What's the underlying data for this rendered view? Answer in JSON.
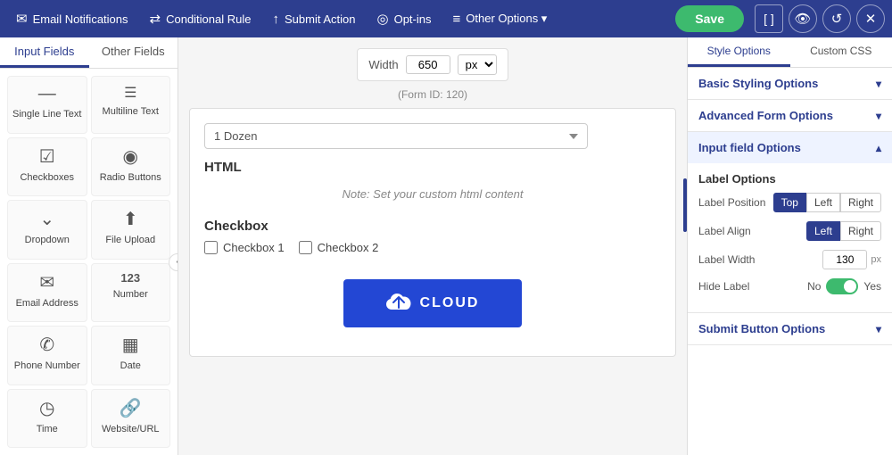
{
  "nav": {
    "items": [
      {
        "id": "email-notifications",
        "icon": "✉",
        "label": "Email Notifications"
      },
      {
        "id": "conditional-rule",
        "icon": "⇄",
        "label": "Conditional Rule"
      },
      {
        "id": "submit-action",
        "icon": "↑",
        "label": "Submit Action"
      },
      {
        "id": "opt-ins",
        "icon": "◎",
        "label": "Opt-ins"
      },
      {
        "id": "other-options",
        "icon": "≡",
        "label": "Other Options ▾"
      }
    ],
    "save_label": "Save"
  },
  "left_panel": {
    "tabs": [
      {
        "id": "input-fields",
        "label": "Input Fields"
      },
      {
        "id": "other-fields",
        "label": "Other Fields"
      }
    ],
    "active_tab": "input-fields",
    "fields": [
      {
        "id": "single-line-text",
        "icon": "—",
        "label": "Single Line Text"
      },
      {
        "id": "multiline-text",
        "icon": "☰",
        "label": "Multiline Text"
      },
      {
        "id": "checkboxes",
        "icon": "☑",
        "label": "Checkboxes"
      },
      {
        "id": "radio-buttons",
        "icon": "◉",
        "label": "Radio Buttons"
      },
      {
        "id": "dropdown",
        "icon": "⌄",
        "label": "Dropdown"
      },
      {
        "id": "file-upload",
        "icon": "⬆",
        "label": "File Upload"
      },
      {
        "id": "email-address",
        "icon": "✉",
        "label": "Email Address"
      },
      {
        "id": "number",
        "icon": "123",
        "label": "Number"
      },
      {
        "id": "phone-number",
        "icon": "✆",
        "label": "Phone Number"
      },
      {
        "id": "date",
        "icon": "▦",
        "label": "Date"
      },
      {
        "id": "time",
        "icon": "◷",
        "label": "Time"
      },
      {
        "id": "website-url",
        "icon": "🔗",
        "label": "Website/URL"
      }
    ]
  },
  "canvas": {
    "width_label": "Width",
    "width_value": "650",
    "px_label": "px",
    "form_id": "(Form ID: 120)",
    "dropdown_value": "1 Dozen",
    "html_label": "HTML",
    "html_note": "Note: Set your custom html content",
    "checkbox_label": "Checkbox",
    "checkboxes": [
      {
        "id": "cb1",
        "label": "Checkbox 1"
      },
      {
        "id": "cb2",
        "label": "Checkbox 2"
      }
    ],
    "cloud_text": "CLOUD"
  },
  "right_panel": {
    "tabs": [
      {
        "id": "style-options",
        "label": "Style Options"
      },
      {
        "id": "custom-css",
        "label": "Custom CSS"
      }
    ],
    "active_tab": "style-options",
    "accordions": [
      {
        "id": "basic-styling",
        "label": "Basic Styling Options",
        "open": false
      },
      {
        "id": "advanced-form",
        "label": "Advanced Form Options",
        "open": false
      },
      {
        "id": "input-field-options",
        "label": "Input field Options",
        "open": true
      }
    ],
    "label_options": {
      "title": "Label Options",
      "label_position": {
        "label": "Label Position",
        "options": [
          "Top",
          "Left",
          "Right"
        ],
        "active": "Top"
      },
      "label_align": {
        "label": "Label Align",
        "options": [
          "Left",
          "Right"
        ],
        "active": "Left"
      },
      "label_width": {
        "label": "Label Width",
        "value": "130",
        "unit": "px"
      },
      "hide_label": {
        "label": "Hide Label",
        "no_label": "No",
        "yes_label": "Yes",
        "checked": true
      }
    },
    "submit_button_options": {
      "label": "Submit Button Options"
    }
  }
}
